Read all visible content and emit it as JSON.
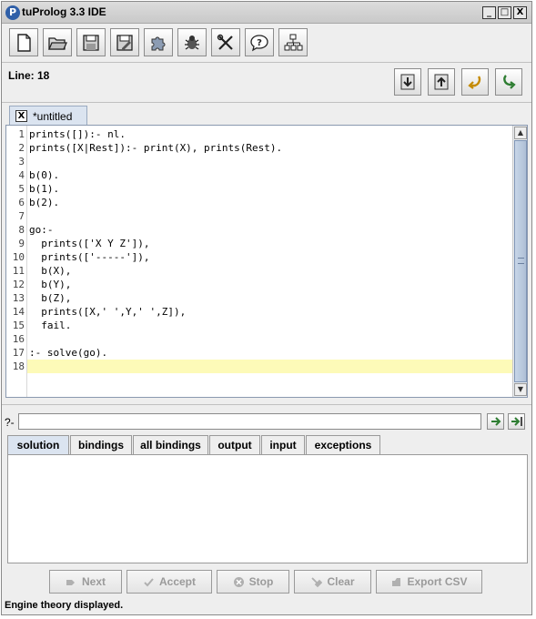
{
  "window": {
    "title": "tuProlog 3.3 IDE",
    "minimize": "_",
    "maximize": "□",
    "close": "X"
  },
  "toolbar": {
    "buttons": [
      "new-file",
      "open-file",
      "save",
      "save-as",
      "libraries",
      "spy-debug",
      "preferences",
      "help",
      "consult-theory"
    ]
  },
  "linebar": {
    "line_label": "Line: 18"
  },
  "editor": {
    "tab_label": "*untitled",
    "tab_close": "X",
    "current_line": 18,
    "lines": [
      "prints([]):- nl.",
      "prints([X|Rest]):- print(X), prints(Rest).",
      "",
      "b(0).",
      "b(1).",
      "b(2).",
      "",
      "go:-",
      "  prints(['X Y Z']),",
      "  prints(['-----']),",
      "  b(X),",
      "  b(Y),",
      "  b(Z),",
      "  prints([X,' ',Y,' ',Z]),",
      "  fail.",
      "",
      ":- solve(go).",
      ""
    ]
  },
  "query": {
    "prompt": "?-",
    "value": ""
  },
  "result_tabs": [
    "solution",
    "bindings",
    "all bindings",
    "output",
    "input",
    "exceptions"
  ],
  "active_result_tab": "solution",
  "buttons": {
    "next": "Next",
    "accept": "Accept",
    "stop": "Stop",
    "clear": "Clear",
    "export": "Export CSV"
  },
  "status": "Engine theory displayed.",
  "colors": {
    "current_line_highlight": "#fdfab8",
    "active_tab": "#dbe4f0",
    "predicate": "#a0006e",
    "variable": "#3b3bb8"
  }
}
